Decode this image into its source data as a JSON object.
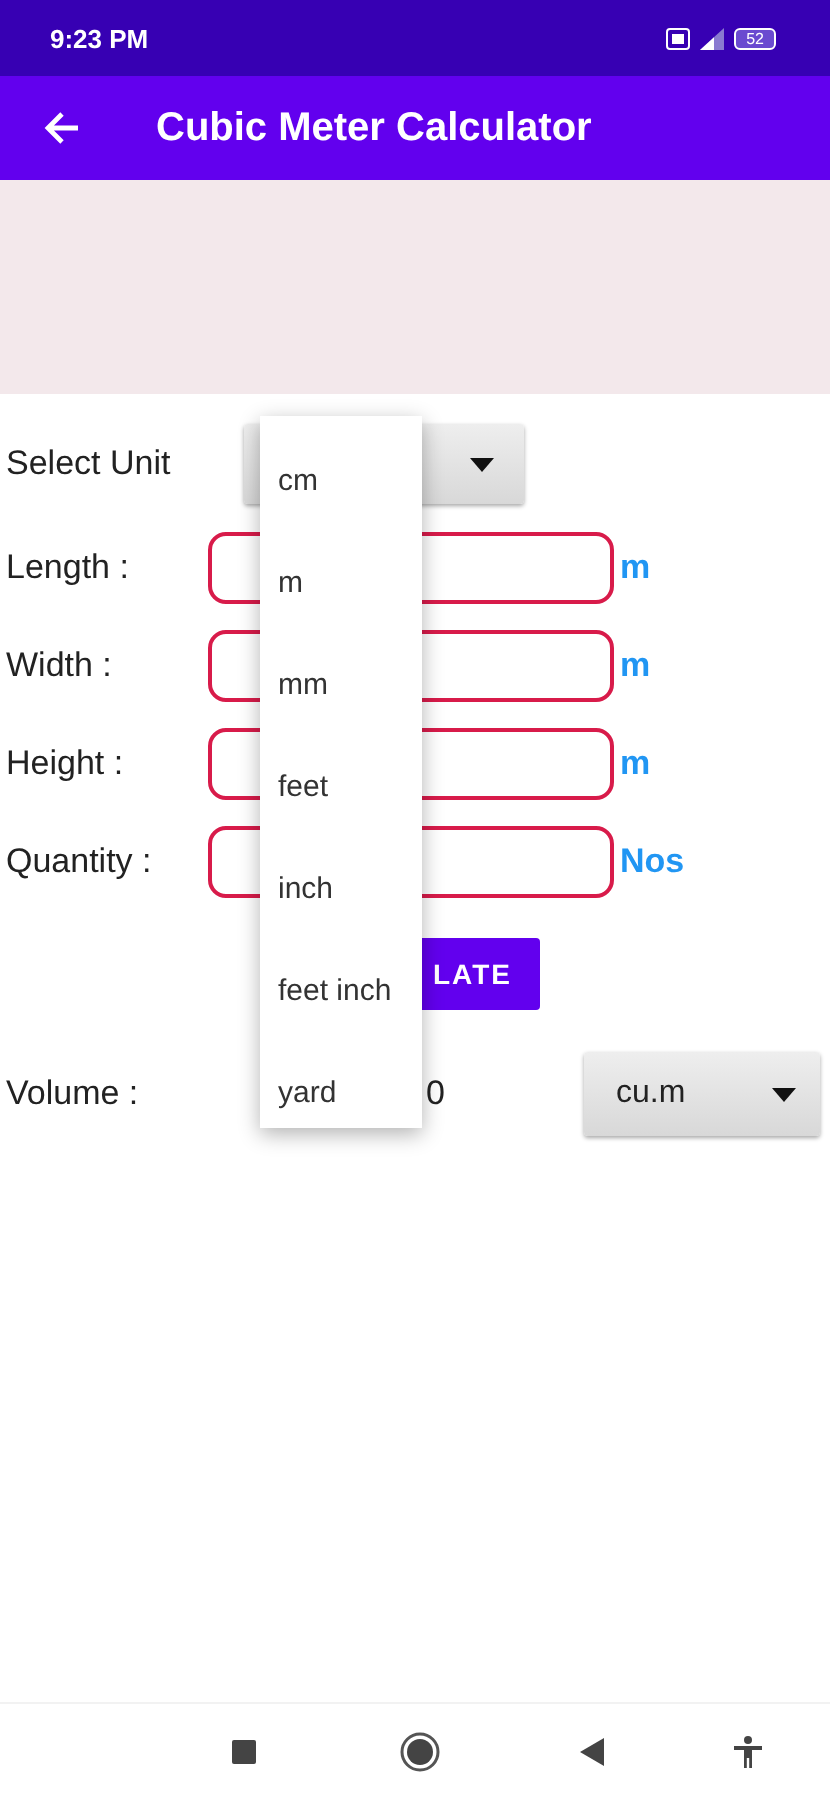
{
  "status_bar": {
    "time": "9:23 PM",
    "battery": "52"
  },
  "app_bar": {
    "title": "Cubic Meter Calculator"
  },
  "select_unit": {
    "label": "Select Unit"
  },
  "fields": [
    {
      "label": "Length :",
      "unit": "m"
    },
    {
      "label": "Width :",
      "unit": "m"
    },
    {
      "label": "Height :",
      "unit": "m"
    },
    {
      "label": "Quantity :",
      "unit": "Nos"
    }
  ],
  "calculate_button": {
    "label": "LATE"
  },
  "volume": {
    "label": "Volume :",
    "value": "0",
    "unit": "cu.m"
  },
  "dropdown": {
    "options": [
      "cm",
      "m",
      "mm",
      "feet",
      "inch",
      "feet inch",
      "yard"
    ]
  }
}
